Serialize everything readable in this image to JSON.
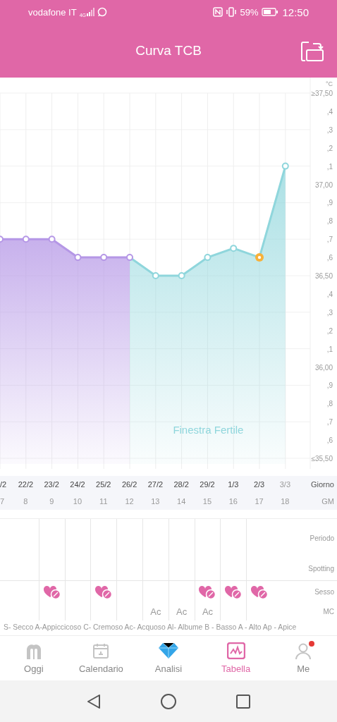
{
  "status_bar": {
    "carrier": "vodafone IT",
    "network": "4G",
    "battery": "59%",
    "time": "12:50"
  },
  "header": {
    "title": "Curva TCB"
  },
  "chart": {
    "chart_data": {
      "type": "area",
      "ylabel": "°C",
      "grid": true,
      "categories": [
        "/2",
        "22/2",
        "23/2",
        "24/2",
        "25/2",
        "26/2",
        "27/2",
        "28/2",
        "29/2",
        "1/3",
        "2/3",
        "3/3"
      ],
      "series": [
        {
          "color": "#b597e6",
          "values": [
            36.7,
            36.7,
            36.7,
            36.6,
            36.6,
            36.6,
            null,
            null,
            null,
            null,
            null,
            null
          ]
        },
        {
          "color": "#8fd6dc",
          "values": [
            null,
            null,
            null,
            null,
            null,
            36.6,
            36.5,
            36.5,
            36.6,
            36.65,
            36.6,
            37.1
          ]
        }
      ],
      "ylim": [
        35.5,
        37.5
      ],
      "yticks": [
        {
          "value": 37.5,
          "label": "≥37,50"
        },
        {
          "value": 37.0,
          "label": "37,00"
        },
        {
          "value": 36.5,
          "label": "36,50"
        },
        {
          "value": 36.0,
          "label": "36,00"
        },
        {
          "value": 35.5,
          "label": "≤35,50"
        }
      ],
      "annotations": [
        "Finestra Fertile"
      ]
    },
    "minor_tick_labels": [
      ",4",
      ",3",
      ",2",
      ",1",
      ",9",
      ",8",
      ",7",
      ",6",
      ",4",
      ",3",
      ",2",
      ",1",
      ",9",
      ",8",
      ",7",
      ",6"
    ]
  },
  "axis": {
    "row_labels": [
      "Giorno",
      "GM"
    ],
    "days": [
      {
        "gm": "7",
        "future": false,
        "ovulation": false
      },
      {
        "gm": "8",
        "future": false,
        "ovulation": false
      },
      {
        "gm": "9",
        "future": false,
        "ovulation": false
      },
      {
        "gm": "10",
        "future": false,
        "ovulation": false
      },
      {
        "gm": "11",
        "future": false,
        "ovulation": false
      },
      {
        "gm": "12",
        "future": false,
        "ovulation": false
      },
      {
        "gm": "13",
        "future": false,
        "ovulation": false
      },
      {
        "gm": "14",
        "future": false,
        "ovulation": false
      },
      {
        "gm": "15",
        "future": false,
        "ovulation": false
      },
      {
        "gm": "16",
        "future": false,
        "ovulation": false
      },
      {
        "gm": "17",
        "future": false,
        "ovulation": true
      },
      {
        "gm": "18",
        "future": true,
        "ovulation": false
      }
    ]
  },
  "symptom_table": {
    "row_labels": [
      "Periodo",
      "Spotting",
      "Sesso",
      "MC"
    ],
    "days": [
      {
        "sex": false
      },
      {
        "sex": false
      },
      {
        "sex": true
      },
      {
        "sex": false
      },
      {
        "sex": true
      },
      {
        "sex": false
      },
      {
        "sex": false,
        "mc": "Ac"
      },
      {
        "sex": false,
        "mc": "Ac"
      },
      {
        "sex": true,
        "mc": "Ac"
      },
      {
        "sex": true
      },
      {
        "sex": true
      },
      {
        "sex": false
      }
    ]
  },
  "legend": "S- Secco A-Appiccicoso C- Cremoso Ac- Acquoso Al- Albume B - Basso A - Alto Ap - Apice",
  "nav": {
    "items": [
      {
        "kind": "today",
        "label": "Oggi",
        "selected": false,
        "badge": false
      },
      {
        "kind": "calendar",
        "label": "Calendario",
        "selected": false,
        "badge": false
      },
      {
        "kind": "analysis",
        "label": "Analisi",
        "selected": false,
        "badge": false
      },
      {
        "kind": "chart",
        "label": "Tabella",
        "selected": true,
        "badge": false
      },
      {
        "kind": "profile",
        "label": "Me",
        "selected": false,
        "badge": true
      }
    ]
  }
}
